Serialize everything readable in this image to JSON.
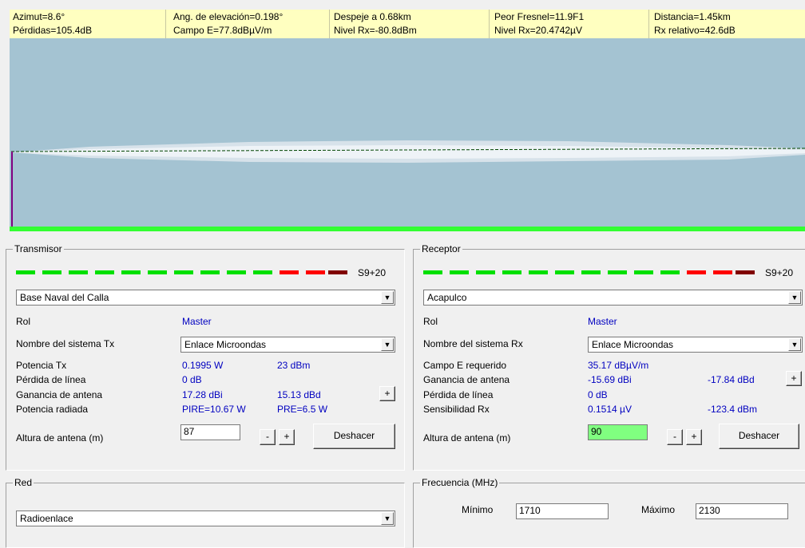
{
  "info": {
    "azimuth": "Azimut=8.6°",
    "losses": "Pérdidas=105.4dB",
    "elevation": "Ang. de elevación=0.198°",
    "field": "Campo E=77.8dBµV/m",
    "clearance": "Despeje a 0.68km",
    "rx_level_dbm": "Nivel Rx=-80.8dBm",
    "worst_fresnel": "Peor Fresnel=11.9F1",
    "rx_level_uv": "Nivel Rx=20.4742µV",
    "distance": "Distancia=1.45km",
    "rx_relative": "Rx relativo=42.6dB"
  },
  "transmitter": {
    "title": "Transmisor",
    "signal": "S9+20",
    "site": "Base Naval del Calla",
    "role_label": "Rol",
    "role_value": "Master",
    "system_label": "Nombre del sistema Tx",
    "system_value": "Enlace Microondas",
    "power_label": "Potencia Tx",
    "power_w": "0.1995 W",
    "power_dbm": "23 dBm",
    "line_loss_label": "Pérdida de línea",
    "line_loss_value": "0 dB",
    "gain_label": "Ganancia de antena",
    "gain_dbi": "17.28 dBi",
    "gain_dbd": "15.13 dBd",
    "radiated_label": "Potencia radiada",
    "pire": "PIRE=10.67 W",
    "pre": "PRE=6.5 W",
    "height_label": "Altura de antena (m)",
    "height_value": "87",
    "minus": "-",
    "plus": "+",
    "undo": "Deshacer"
  },
  "receiver": {
    "title": "Receptor",
    "signal": "S9+20",
    "site": "Acapulco",
    "role_label": "Rol",
    "role_value": "Master",
    "system_label": "Nombre del sistema Rx",
    "system_value": "Enlace Microondas",
    "field_label": "Campo E requerido",
    "field_value": "35.17 dBµV/m",
    "gain_label": "Ganancia de antena",
    "gain_dbi": "-15.69 dBi",
    "gain_dbd": "-17.84 dBd",
    "line_loss_label": "Pérdida de línea",
    "line_loss_value": "0 dB",
    "sens_label": "Sensibilidad Rx",
    "sens_uv": "0.1514 µV",
    "sens_dbm": "-123.4 dBm",
    "height_label": "Altura de antena (m)",
    "height_value": "90",
    "minus": "-",
    "plus": "+",
    "undo": "Deshacer"
  },
  "network": {
    "title": "Red",
    "value": "Radioenlace"
  },
  "frequency": {
    "title": "Frecuencia (MHz)",
    "min_label": "Mínimo",
    "min_value": "1710",
    "max_label": "Máximo",
    "max_value": "2130"
  },
  "colors": {
    "sky": "#a4c3d2",
    "ground": "#33ff33",
    "path": "#006600",
    "meter_green": "#00e000",
    "meter_red": "#ff0000",
    "meter_dark": "#800000",
    "highlight_field": "#80ff80"
  }
}
